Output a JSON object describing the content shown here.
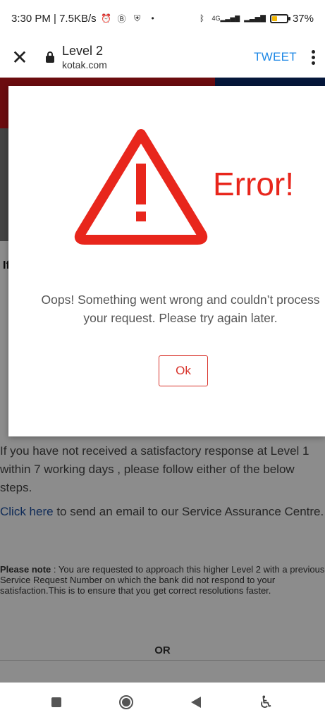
{
  "status_bar": {
    "time_speed": "3:30 PM | 7.5KB/s",
    "icons": [
      "alarm-icon",
      "b-icon",
      "shield-icon",
      "dot-icon",
      "bluetooth-icon",
      "signal-4g-icon",
      "signal-icon",
      "battery-icon"
    ],
    "network_label": "4G",
    "battery_percent": "37%",
    "battery_level": 0.37
  },
  "toolbar": {
    "close_label": "✕",
    "title": "Level 2",
    "domain": "kotak.com",
    "tweet_label": "TWEET"
  },
  "page": {
    "fragment": "If",
    "para1": "If you have not received a satisfactory response at Level 1 within 7 working days , please follow either of the below steps.",
    "link_text": "Click here",
    "para2_rest": " to send an email to our Service Assurance Centre.",
    "note_label": "Please note",
    "note_text": " : You are requested to approach this higher Level 2 with a previous Service Request Number on which the bank did not respond to your satisfaction.This is to ensure that you get correct resolutions faster.",
    "or_text": "OR"
  },
  "modal": {
    "error_title": "Error!",
    "message": "Oops! Something went wrong and couldn’t process\nyour request. Please try again later.",
    "ok_label": "Ok",
    "accent_color": "#e8261c"
  }
}
